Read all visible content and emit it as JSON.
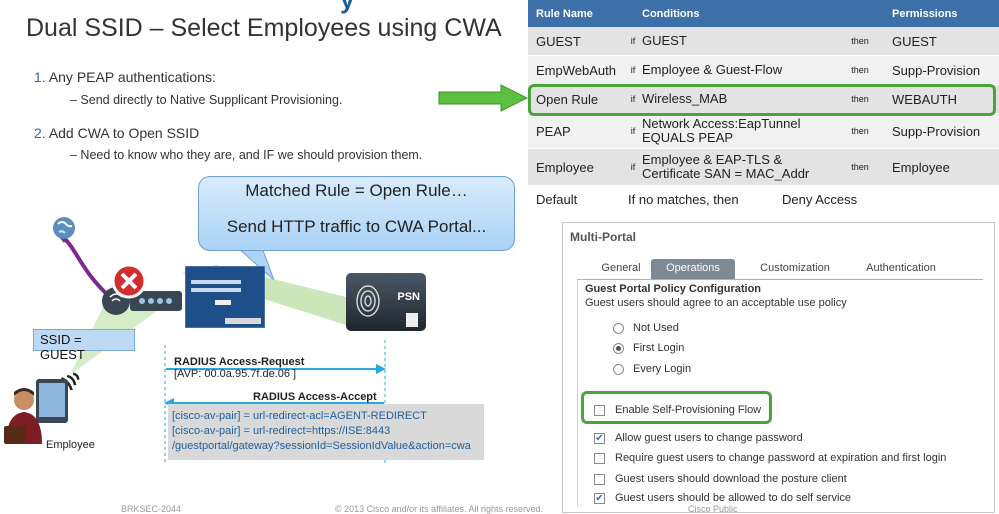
{
  "slide": {
    "title_fragment": "y",
    "title": "Dual SSID – Select Employees using CWA",
    "points": [
      {
        "num": "1.",
        "text": "Any PEAP authentications:",
        "sub": "– Send directly to Native Supplicant Provisioning."
      },
      {
        "num": "2.",
        "text": "Add CWA to Open SSID",
        "sub": "– Need to know who they are, and IF we should provision them."
      }
    ]
  },
  "rules": {
    "headers": [
      "Rule Name",
      "Conditions",
      "Permissions"
    ],
    "rows": [
      {
        "name": "GUEST",
        "if": "if",
        "cond": "GUEST",
        "then": "then",
        "perm": "GUEST"
      },
      {
        "name": "EmpWebAuth",
        "if": "if",
        "cond": "Employee & Guest-Flow",
        "then": "then",
        "perm": "Supp-Provision"
      },
      {
        "name": "Open Rule",
        "if": "if",
        "cond": "Wireless_MAB",
        "then": "then",
        "perm": "WEBAUTH"
      },
      {
        "name": "PEAP",
        "if": "if",
        "cond": "Network Access:EapTunnel EQUALS PEAP",
        "then": "then",
        "perm": "Supp-Provision"
      },
      {
        "name": "Employee",
        "if": "if",
        "cond": "Employee & EAP-TLS & Certificate SAN = MAC_Addr",
        "then": "then",
        "perm": "Employee"
      },
      {
        "name": "Default",
        "cond": "If no matches, then",
        "perm": "Deny Access"
      }
    ]
  },
  "bubble": {
    "line1": "Matched Rule = Open Rule…",
    "line2": "Send HTTP traffic to CWA Portal..."
  },
  "network": {
    "psn_label": "PSN",
    "ssid_label": "SSID = GUEST",
    "employee_label": "Employee",
    "radius_request": "RADIUS Access-Request",
    "avp": "[AVP: 00.0a.95.7f.de.06 ]",
    "radius_accept": "RADIUS Access-Accept",
    "pair1": "[cisco-av-pair] = url-redirect-acl=AGENT-REDIRECT",
    "pair2": "[cisco-av-pair] = url-redirect=https://ISE:8443",
    "pair3": "/guestportal/gateway?sessionId=SessionIdValue&action=cwa"
  },
  "portal": {
    "title": "Multi-Portal",
    "tabs": [
      "General",
      "Operations",
      "Customization",
      "Authentication"
    ],
    "active_tab": "Operations",
    "section_title": "Guest Portal Policy Configuration",
    "section_desc": "Guest users should agree to an acceptable use policy",
    "radios": [
      {
        "label": "Not Used",
        "checked": false
      },
      {
        "label": "First Login",
        "checked": true
      },
      {
        "label": "Every Login",
        "checked": false
      }
    ],
    "checkboxes": [
      {
        "label": "Enable Self-Provisioning Flow",
        "checked": false
      },
      {
        "label": "Allow guest users to change password",
        "checked": true
      },
      {
        "label": "Require guest users to change password at expiration and first login",
        "checked": false
      },
      {
        "label": "Guest users should download the posture client",
        "checked": false
      },
      {
        "label": "Guest users should be allowed to do self service",
        "checked": true
      }
    ]
  },
  "footer": {
    "left": "BRKSEC-2044",
    "center": "© 2013 Cisco and/or its affiliates. All rights reserved.",
    "right": "Cisco Public"
  },
  "colors": {
    "accent": "#1f6fb2",
    "header": "#3d6fa8",
    "highlight": "#4aa43a",
    "arrow": "#5cbf3f",
    "radius_arrow": "#2aa8e0"
  }
}
